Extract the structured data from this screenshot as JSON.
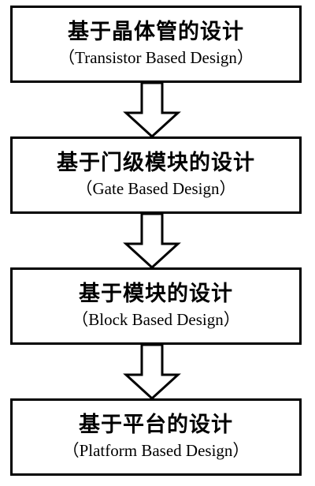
{
  "stages": [
    {
      "title": "基于晶体管的设计",
      "subtitle": "（Transistor Based Design）"
    },
    {
      "title": "基于门级模块的设计",
      "subtitle": "（Gate Based Design）"
    },
    {
      "title": "基于模块的设计",
      "subtitle": "（Block Based Design）"
    },
    {
      "title": "基于平台的设计",
      "subtitle": "（Platform Based Design）"
    }
  ]
}
